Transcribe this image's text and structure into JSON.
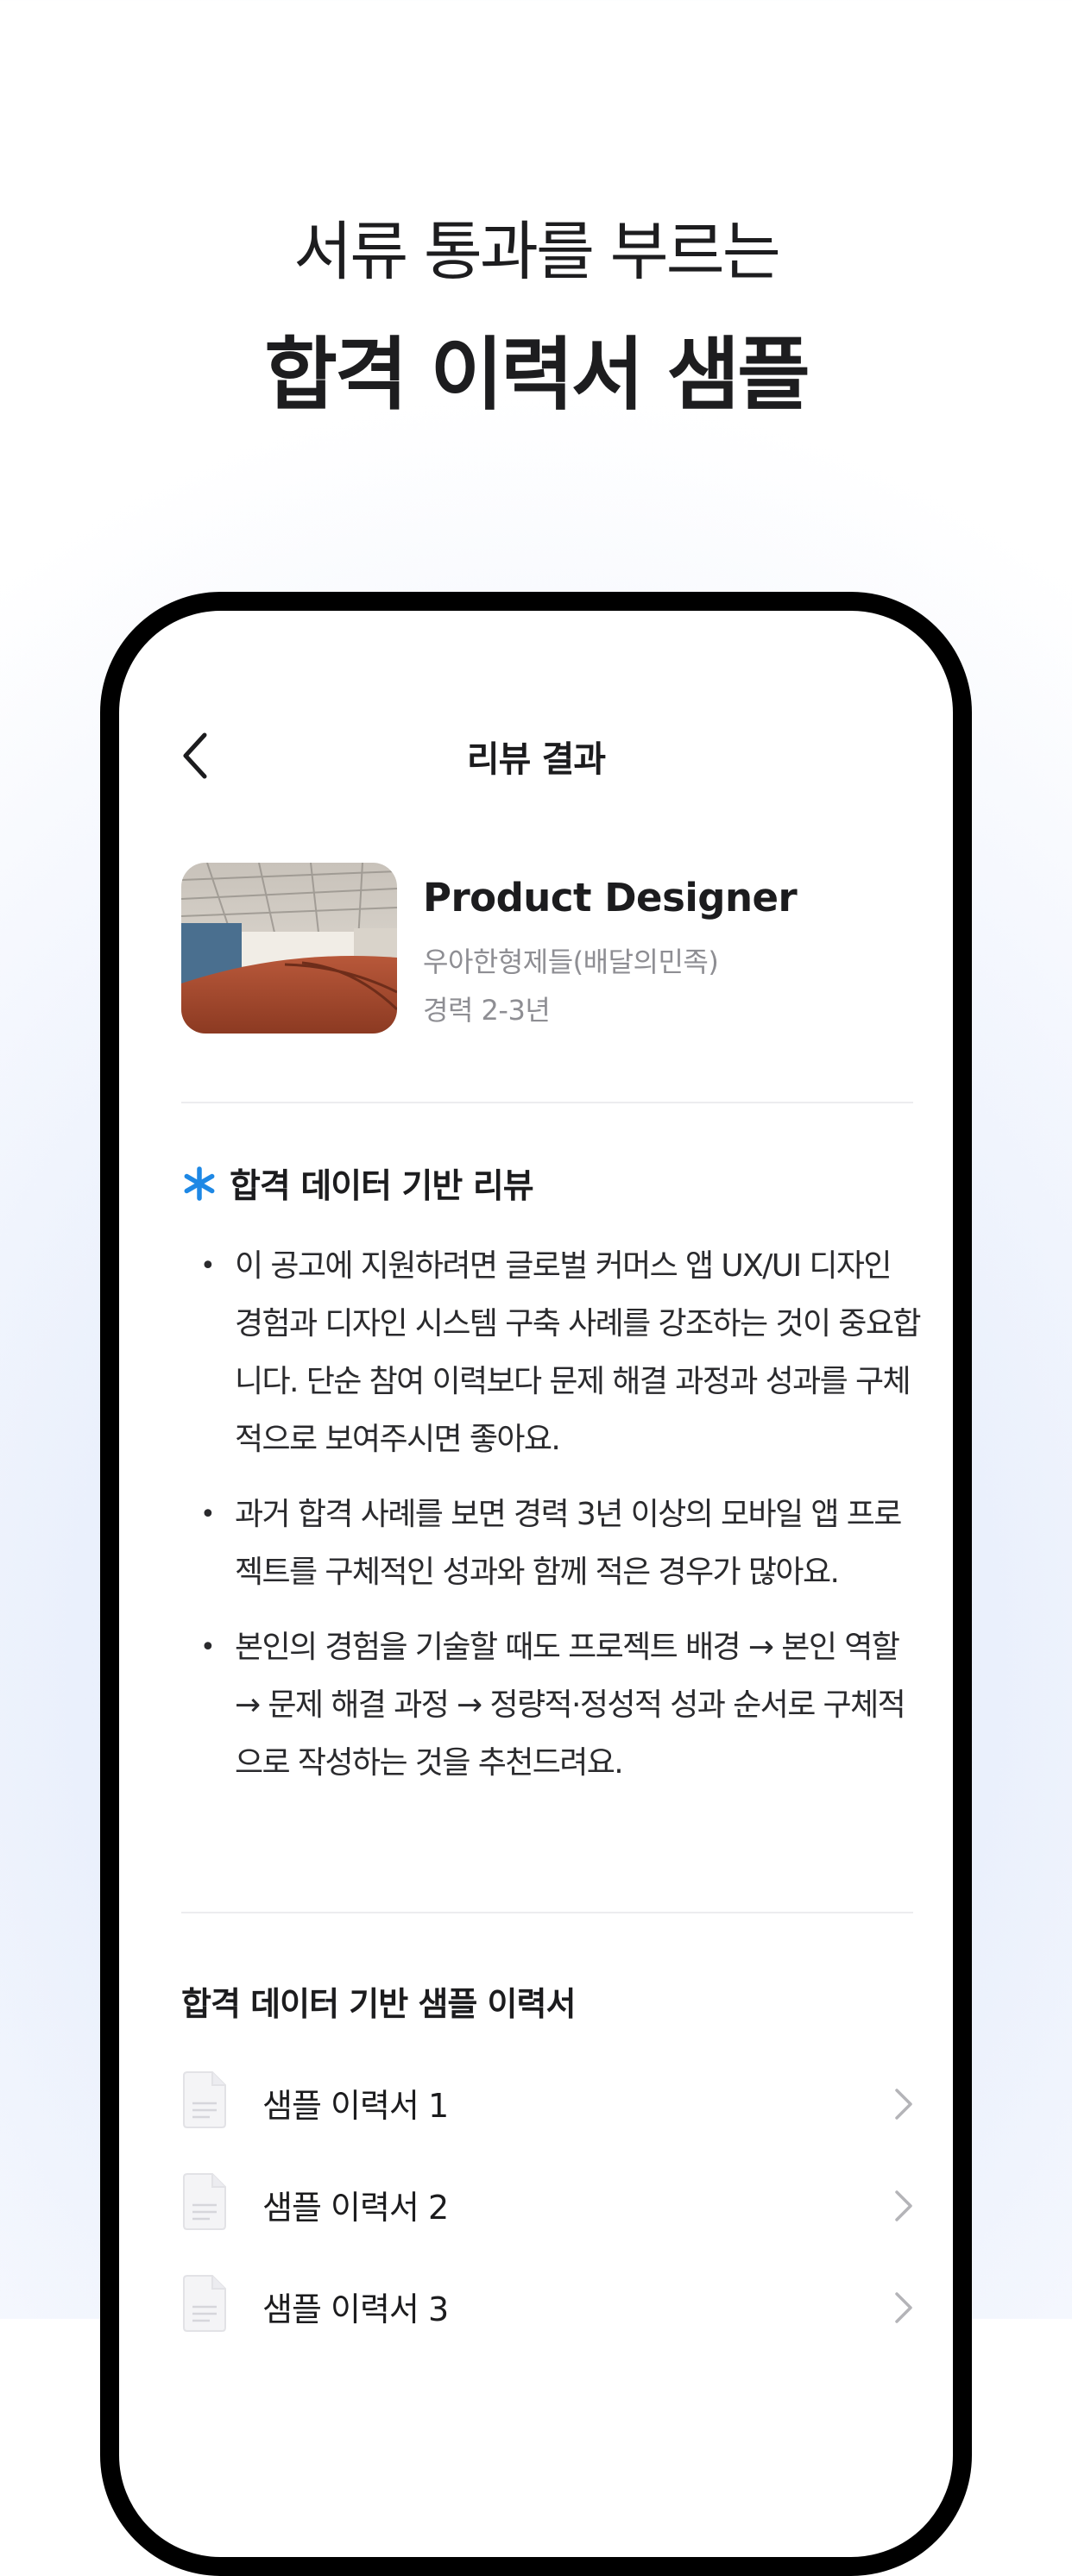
{
  "headline": {
    "line1": "서류 통과를 부르는",
    "line2": "합격 이력서 샘플"
  },
  "nav": {
    "back_icon": "chevron-left-icon",
    "title": "리뷰 결과"
  },
  "job": {
    "title": "Product Designer",
    "company": "우아한형제들(배달의민족)",
    "experience": "경력 2-3년"
  },
  "review": {
    "icon": "asterisk-icon",
    "accent_color": "#1e88e5",
    "heading": "합격 데이터 기반 리뷰",
    "bullets": [
      "이 공고에 지원하려면 글로벌 커머스 앱 UX/UI 디자인 경험과 디자인 시스템 구축 사례를 강조하는 것이 중요합니다. 단순 참여 이력보다 문제 해결 과정과 성과를 구체적으로 보여주시면 좋아요.",
      "과거 합격 사례를 보면 경력 3년 이상의 모바일 앱 프로젝트를 구체적인 성과와 함께 적은 경우가 많아요.",
      "본인의 경험을 기술할 때도 프로젝트 배경 → 본인 역할 → 문제 해결 과정 → 정량적·정성적 성과 순서로 구체적으로 작성하는 것을 추천드려요."
    ]
  },
  "samples": {
    "heading": "합격 데이터 기반 샘플 이력서",
    "items": [
      {
        "label": "샘플 이력서 1"
      },
      {
        "label": "샘플 이력서 2"
      },
      {
        "label": "샘플 이력서 3"
      }
    ]
  }
}
